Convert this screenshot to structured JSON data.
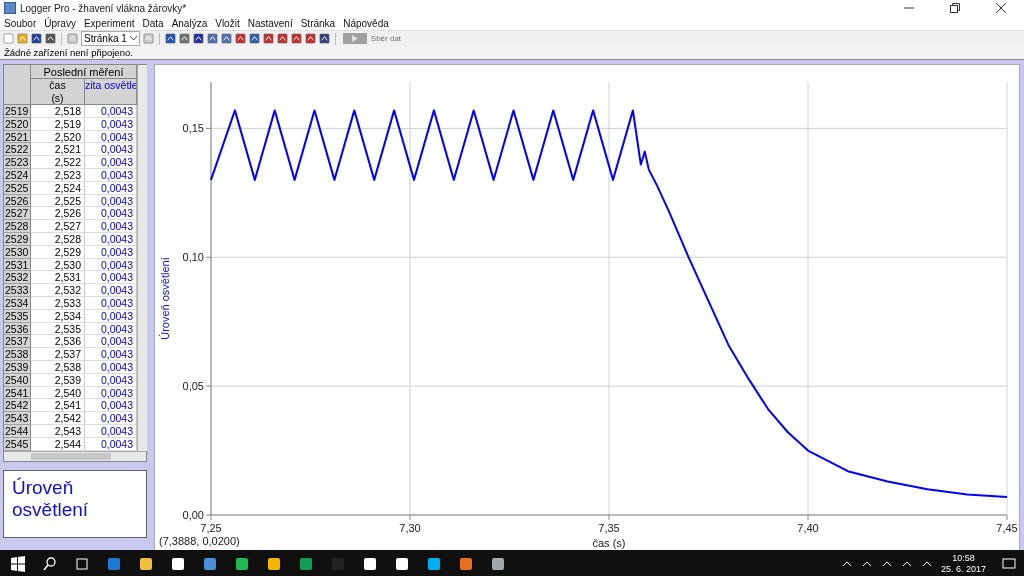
{
  "window": {
    "title": "Logger Pro - žhavení vlákna žárovky*"
  },
  "menu": [
    "Soubor",
    "Úpravy",
    "Experiment",
    "Data",
    "Analýza",
    "Vložit",
    "Nastavení",
    "Stránka",
    "Nápověda"
  ],
  "toolbar": {
    "page_select": "Stránka 1",
    "collect_button": {
      "label": "Sběr dat",
      "disabled": true
    }
  },
  "status": "Žádné zařízení není připojeno.",
  "table": {
    "group": "Poslední měření",
    "columns": [
      "",
      "čas (s)",
      "zita osvětle"
    ],
    "rows": [
      [
        "2519",
        "2,518",
        "0,0043"
      ],
      [
        "2520",
        "2,519",
        "0,0043"
      ],
      [
        "2521",
        "2,520",
        "0,0043"
      ],
      [
        "2522",
        "2,521",
        "0,0043"
      ],
      [
        "2523",
        "2,522",
        "0,0043"
      ],
      [
        "2524",
        "2,523",
        "0,0043"
      ],
      [
        "2525",
        "2,524",
        "0,0043"
      ],
      [
        "2526",
        "2,525",
        "0,0043"
      ],
      [
        "2527",
        "2,526",
        "0,0043"
      ],
      [
        "2528",
        "2,527",
        "0,0043"
      ],
      [
        "2529",
        "2,528",
        "0,0043"
      ],
      [
        "2530",
        "2,529",
        "0,0043"
      ],
      [
        "2531",
        "2,530",
        "0,0043"
      ],
      [
        "2532",
        "2,531",
        "0,0043"
      ],
      [
        "2533",
        "2,532",
        "0,0043"
      ],
      [
        "2534",
        "2,533",
        "0,0043"
      ],
      [
        "2535",
        "2,534",
        "0,0043"
      ],
      [
        "2536",
        "2,535",
        "0,0043"
      ],
      [
        "2537",
        "2,536",
        "0,0043"
      ],
      [
        "2538",
        "2,537",
        "0,0043"
      ],
      [
        "2539",
        "2,538",
        "0,0043"
      ],
      [
        "2540",
        "2,539",
        "0,0043"
      ],
      [
        "2541",
        "2,540",
        "0,0043"
      ],
      [
        "2542",
        "2,541",
        "0,0043"
      ],
      [
        "2543",
        "2,542",
        "0,0043"
      ],
      [
        "2544",
        "2,543",
        "0,0043"
      ],
      [
        "2545",
        "2,544",
        "0,0043"
      ]
    ]
  },
  "legend_box": "Úroveň osvětlení",
  "graph": {
    "coordinates": "(7,3888, 0,0200)",
    "chart_data": {
      "type": "line",
      "grid": true,
      "xlabel": "čas (s)",
      "ylabel": "Úroveň osvětlení",
      "xlim": [
        7.25,
        7.45
      ],
      "ylim": [
        0,
        0.168
      ],
      "xticks": [
        {
          "value": 7.25,
          "label": "7,25"
        },
        {
          "value": 7.3,
          "label": "7,30"
        },
        {
          "value": 7.35,
          "label": "7,35"
        },
        {
          "value": 7.4,
          "label": "7,40"
        },
        {
          "value": 7.45,
          "label": "7,45"
        }
      ],
      "yticks": [
        {
          "value": 0,
          "label": "0,00"
        },
        {
          "value": 0.05,
          "label": "0,05"
        },
        {
          "value": 0.1,
          "label": "0,10"
        },
        {
          "value": 0.15,
          "label": "0,15"
        }
      ],
      "x": [
        7.25,
        7.256,
        7.261,
        7.266,
        7.271,
        7.276,
        7.281,
        7.286,
        7.291,
        7.296,
        7.301,
        7.306,
        7.311,
        7.316,
        7.321,
        7.326,
        7.331,
        7.336,
        7.341,
        7.346,
        7.351,
        7.356,
        7.358,
        7.359,
        7.36,
        7.362,
        7.365,
        7.37,
        7.375,
        7.38,
        7.385,
        7.39,
        7.395,
        7.4,
        7.41,
        7.42,
        7.43,
        7.44,
        7.45
      ],
      "series": [
        {
          "color": "#0000ff",
          "values": [
            0.13,
            0.157,
            0.13,
            0.157,
            0.13,
            0.157,
            0.13,
            0.157,
            0.13,
            0.157,
            0.13,
            0.157,
            0.13,
            0.157,
            0.13,
            0.157,
            0.13,
            0.157,
            0.13,
            0.157,
            0.13,
            0.157,
            0.136,
            0.141,
            0.134,
            0.128,
            0.118,
            0.1,
            0.083,
            0.066,
            0.053,
            0.041,
            0.032,
            0.025,
            0.017,
            0.013,
            0.01,
            0.008,
            0.007
          ]
        }
      ]
    }
  },
  "taskbar": {
    "time": "10:58",
    "date": "25. 6. 2017"
  }
}
